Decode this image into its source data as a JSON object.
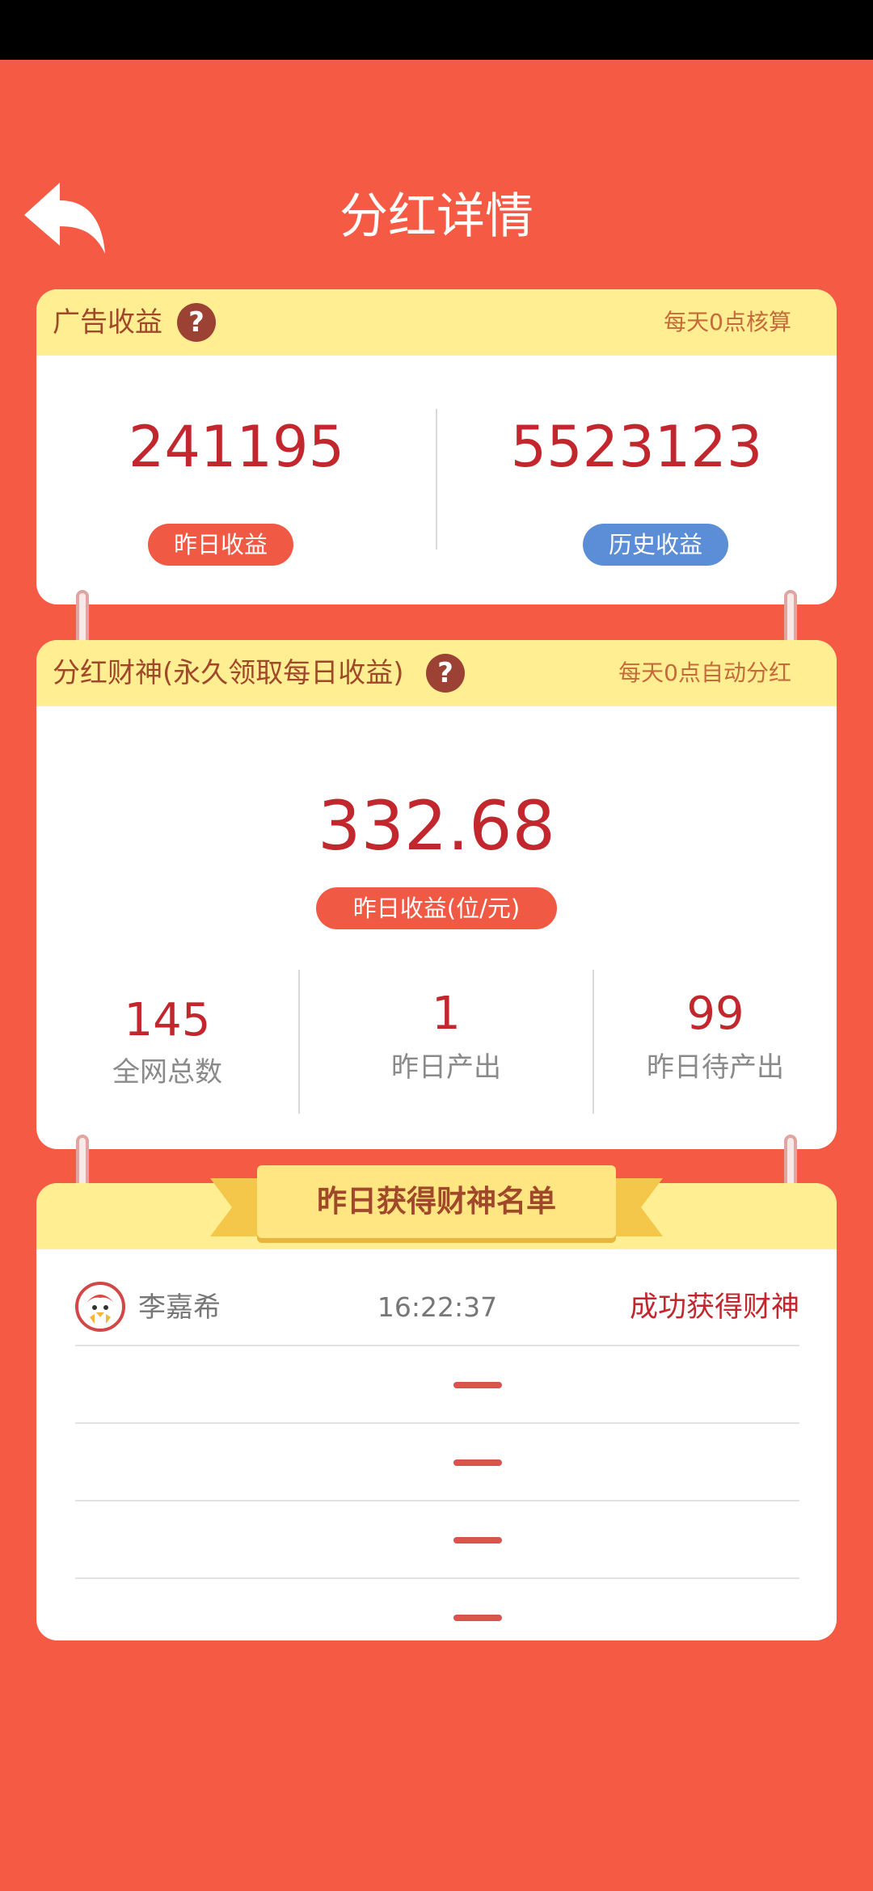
{
  "header": {
    "title": "分红详情"
  },
  "ad_card": {
    "title": "广告收益",
    "note": "每天0点核算",
    "yesterday_value": "241195",
    "yesterday_label": "昨日收益",
    "history_value": "5523123",
    "history_label": "历史收益"
  },
  "dividend_card": {
    "title": "分红财神(永久领取每日收益)",
    "note": "每天0点自动分红",
    "main_value": "332.68",
    "main_label": "昨日收益(位/元)",
    "stats": [
      {
        "value": "145",
        "label": "全网总数"
      },
      {
        "value": "1",
        "label": "昨日产出"
      },
      {
        "value": "99",
        "label": "昨日待产出"
      }
    ]
  },
  "list_card": {
    "ribbon_title": "昨日获得财神名单",
    "rows": [
      {
        "name": "李嘉希",
        "time": "16:22:37",
        "status": "成功获得财神"
      }
    ],
    "placeholder_rows": 4
  },
  "colors": {
    "background": "#F55A45",
    "header_yellow": "#FFEE92",
    "value_red": "#C1272D",
    "pill_red": "#F05A45",
    "pill_blue": "#5B8ED6"
  },
  "icons": [
    "back-arrow-icon",
    "help-icon",
    "avatar-chick-icon"
  ]
}
